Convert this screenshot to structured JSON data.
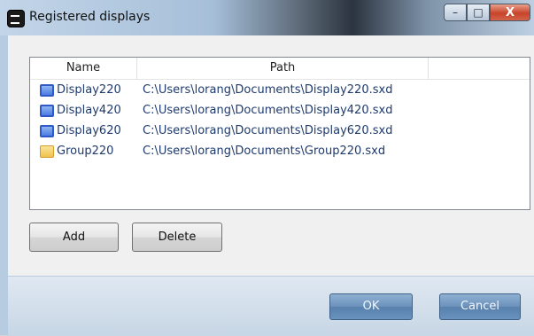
{
  "window": {
    "title": "Registered displays",
    "controls": {
      "minimize": "–",
      "maximize": "□",
      "close": "X"
    }
  },
  "table": {
    "columns": [
      "Name",
      "Path"
    ],
    "rows": [
      {
        "icon": "display-icon",
        "name": "Display220",
        "path": "C:\\Users\\lorang\\Documents\\Display220.sxd"
      },
      {
        "icon": "display-icon",
        "name": "Display420",
        "path": "C:\\Users\\lorang\\Documents\\Display420.sxd"
      },
      {
        "icon": "display-icon",
        "name": "Display620",
        "path": "C:\\Users\\lorang\\Documents\\Display620.sxd"
      },
      {
        "icon": "folder-icon",
        "name": "Group220",
        "path": "C:\\Users\\lorang\\Documents\\Group220.sxd"
      }
    ]
  },
  "buttons": {
    "add": "Add",
    "delete": "Delete",
    "ok": "OK",
    "cancel": "Cancel"
  }
}
